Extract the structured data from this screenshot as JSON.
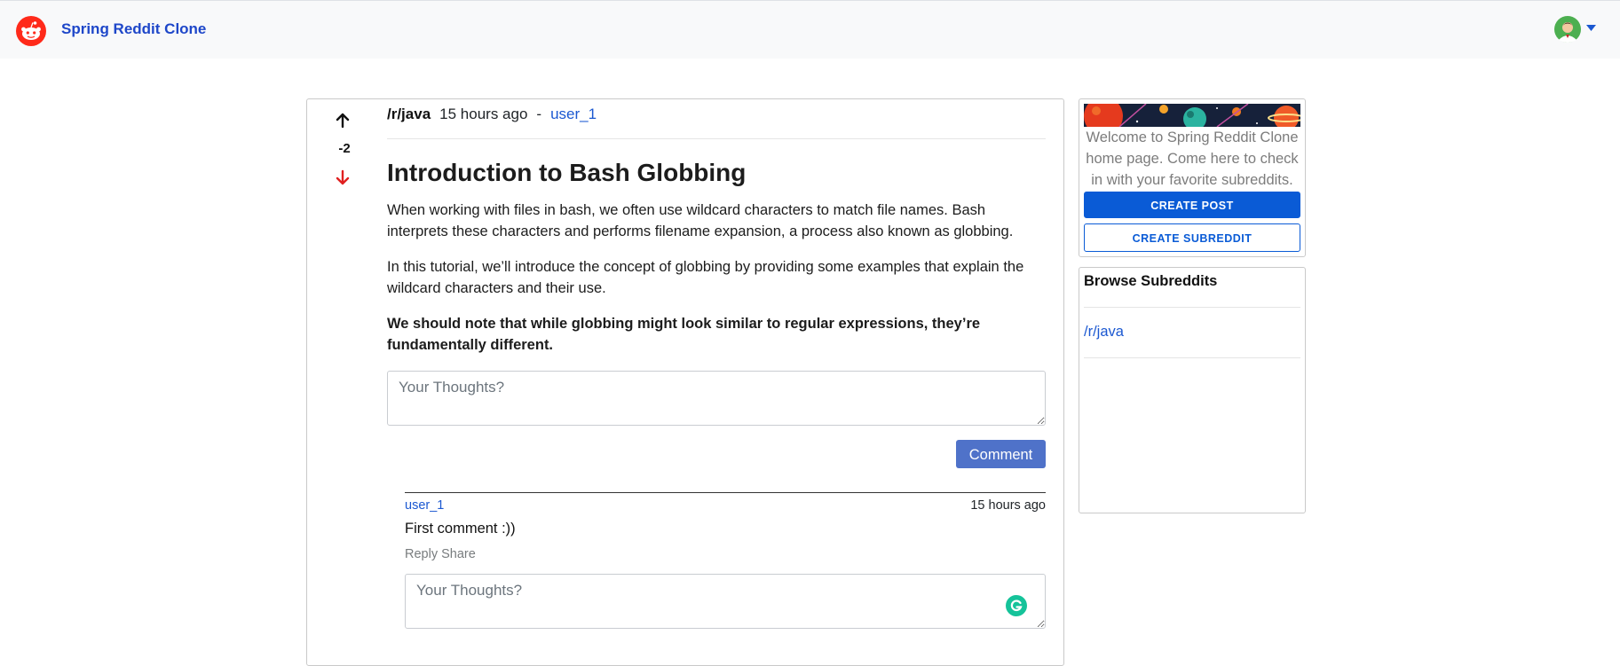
{
  "app": {
    "title": "Spring Reddit Clone"
  },
  "navbar": {
    "logo_icon": "reddit-alien-icon",
    "avatar_icon": "user-avatar-icon",
    "menu_icon": "caret-down-icon"
  },
  "post": {
    "vote_count": "-2",
    "subreddit": "/r/java",
    "time_ago": "15 hours ago",
    "separator": "-",
    "author": "user_1",
    "title": "Introduction to Bash Globbing",
    "paragraphs": [
      "When working with files in bash, we often use wildcard characters to match file names. Bash interprets these characters and performs filename expansion, a process also known as globbing.",
      "In this tutorial, we’ll introduce the concept of globbing by providing some examples that explain the wildcard characters and their use.",
      "We should note that while globbing might look similar to regular expressions, they’re fundamentally different."
    ],
    "comment_placeholder": "Your Thoughts?",
    "comment_button": "Comment",
    "colors": {
      "upvote": "#111111",
      "downvote": "#e02020"
    }
  },
  "comments": [
    {
      "author": "user_1",
      "time_ago": "15 hours ago",
      "text": "First comment :))",
      "actions": [
        "Reply",
        "Share"
      ],
      "reply_placeholder": "Your Thoughts?"
    }
  ],
  "sidebar": {
    "welcome_text": "Welcome to Spring Reddit Clone home page. Come here to check in with your favorite subreddits.",
    "create_post": "CREATE POST",
    "create_subreddit": "CREATE SUBREDDIT",
    "browse_title": "Browse Subreddits",
    "subreddits": [
      "/r/java"
    ]
  },
  "colors": {
    "brand": "#1e47c9",
    "link": "#1b58d1",
    "primary": "#0a5bd6",
    "comment_button": "#4f72c9",
    "reddit_orange": "#ff4500"
  }
}
